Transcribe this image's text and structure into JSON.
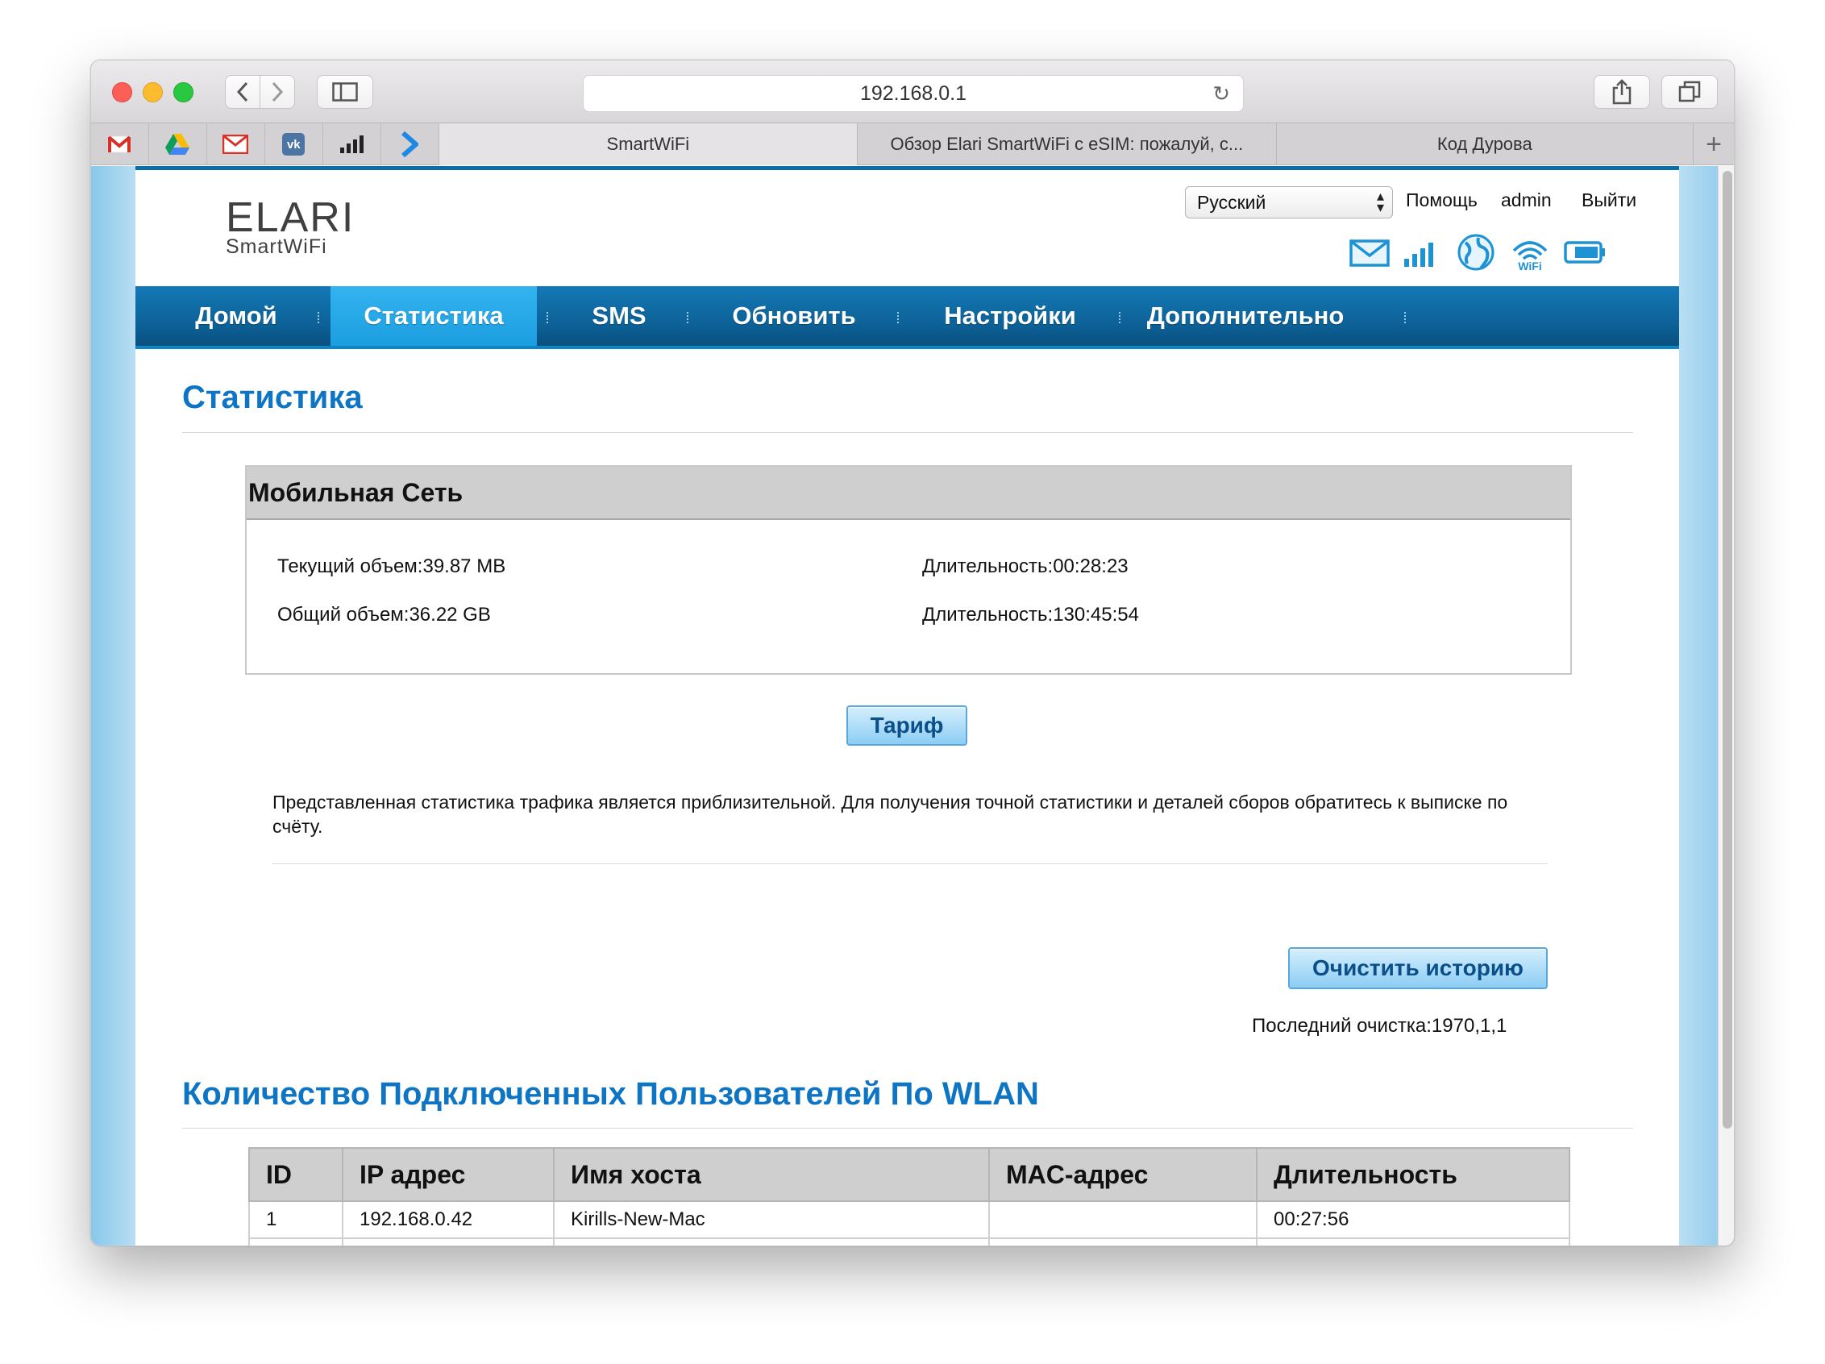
{
  "browser": {
    "url": "192.168.0.1",
    "tabs": [
      {
        "label": "SmartWiFi",
        "active": true
      },
      {
        "label": "Обзор Elari SmartWiFi с eSIM: пожалуй, с...",
        "active": false
      },
      {
        "label": "Код Дурова",
        "active": false
      }
    ],
    "bookmarks": [
      "gmail-icon",
      "drive-icon",
      "mail-icon",
      "vk-icon",
      "signal-bars-icon",
      "arrow-icon"
    ],
    "vk_label": "vk"
  },
  "header": {
    "logo_main": "ELARI",
    "logo_sub": "SmartWiFi",
    "language": "Русский",
    "help": "Помощь",
    "user": "admin",
    "logout": "Выйти",
    "wifi_label": "WiFi"
  },
  "nav": {
    "items": [
      {
        "label": "Домой",
        "active": false
      },
      {
        "label": "Статистика",
        "active": true
      },
      {
        "label": "SMS",
        "active": false
      },
      {
        "label": "Обновить",
        "active": false
      },
      {
        "label": "Настройки",
        "active": false
      },
      {
        "label": "Дополнительно",
        "active": false
      }
    ]
  },
  "stats": {
    "title": "Статистика",
    "panel_title": "Мобильная Сеть",
    "current_volume": "Текущий объем:39.87 MB",
    "current_duration": "Длительность:00:28:23",
    "total_volume": "Общий объем:36.22 GB",
    "total_duration": "Длительность:130:45:54",
    "tariff_button": "Тариф",
    "note": "Представленная статистика трафика является приблизительной. Для получения точной статистики и деталей сборов обратитесь к выписке по счёту.",
    "clear_button": "Очистить историю",
    "last_clear": "Последний очистка:1970,1,1"
  },
  "wlan": {
    "title": "Количество Подключенных Пользователей По WLAN",
    "columns": [
      "ID",
      "IP адрес",
      "Имя хоста",
      "MAC-адрес",
      "Длительность"
    ],
    "rows": [
      [
        "1",
        "192.168.0.42",
        "Kirills-New-Mac",
        "",
        "00:27:56"
      ]
    ]
  },
  "colors": {
    "accent": "#0e74c4",
    "nav": "#0c5f94",
    "nav_active": "#34b3ef",
    "button": "#8ccdf4"
  }
}
